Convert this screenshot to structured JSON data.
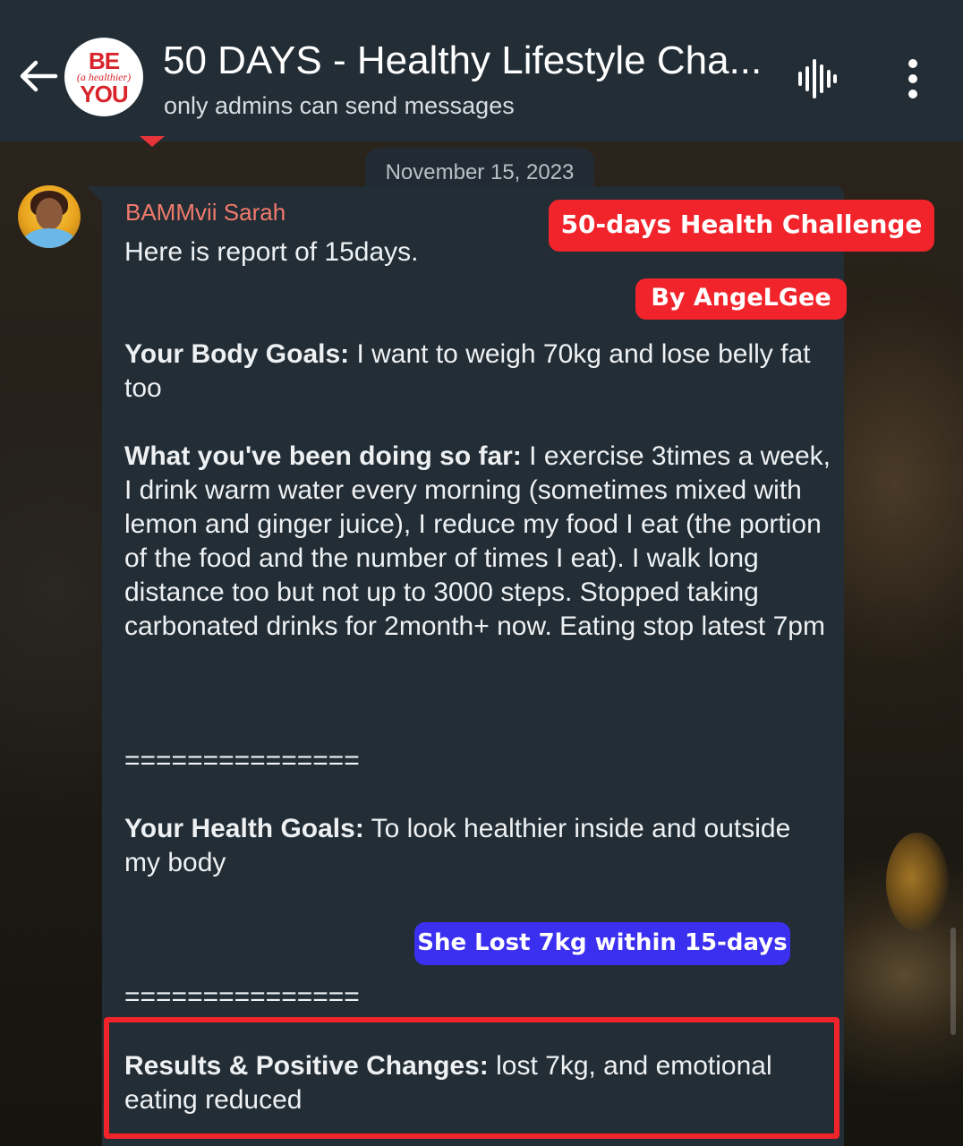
{
  "header": {
    "group_title": "50 DAYS - Healthy Lifestyle Cha...",
    "subtitle": "only admins can send messages",
    "logo": {
      "line1": "BE",
      "line2": "(a healthier)",
      "line3": "YOU"
    },
    "icons": {
      "back": "back-arrow-icon",
      "voice": "voice-chat-icon",
      "menu": "more-vertical-icon"
    }
  },
  "date_chip": "November 15, 2023",
  "message": {
    "sender": "BAMMvii Sarah",
    "intro": "Here is report of 15days.",
    "body_goals_label": "Your Body Goals:",
    "body_goals_text": " I want to weigh 70kg and lose belly fat too",
    "doing_label": "What you've been doing so far:",
    "doing_text": "  I exercise 3times a week, I drink warm water every morning (sometimes mixed with lemon and ginger juice), I reduce my food I eat (the portion of the food and the number of times I eat). I walk long distance too but not up to 3000 steps. Stopped taking carbonated drinks for 2month+ now. Eating stop latest 7pm",
    "separator": "===============",
    "health_goals_label": "Your Health Goals:",
    "health_goals_text": " To look healthier inside and outside my body",
    "results_label": "Results & Positive Changes:",
    "results_text": " lost 7kg, and  emotional eating reduced"
  },
  "overlays": {
    "challenge_badge": "50-days Health Challenge",
    "author_badge": "By AngeLGee",
    "result_badge": "She Lost 7kg within 15-days"
  },
  "colors": {
    "header_bg": "#232d35",
    "bubble_bg": "#232d35",
    "sender_name": "#f07a6c",
    "badge_red": "#f1242c",
    "badge_blue": "#3b2ff0"
  }
}
